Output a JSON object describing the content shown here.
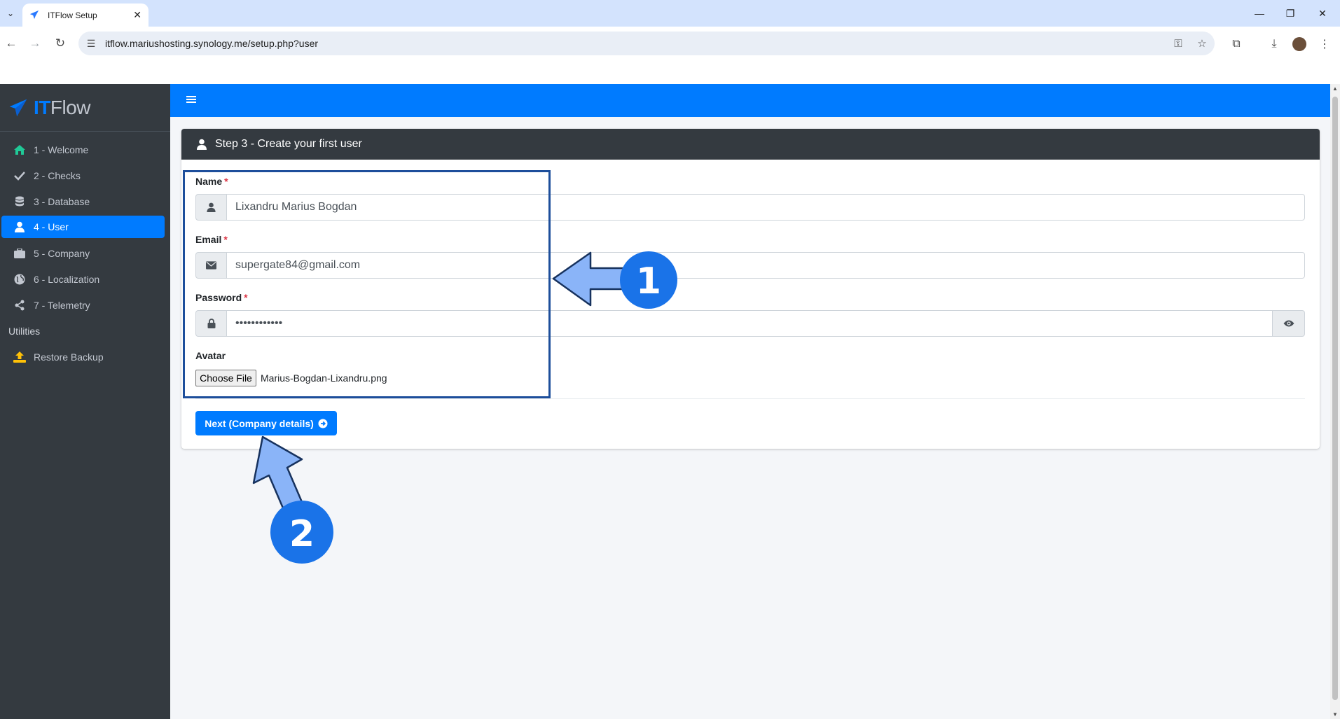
{
  "browser": {
    "tab_title": "ITFlow Setup",
    "url": "itflow.mariushosting.synology.me/setup.php?user"
  },
  "sidebar": {
    "brand_it": "IT",
    "brand_flow": "Flow",
    "items": [
      {
        "label": "1 - Welcome",
        "icon": "home-icon"
      },
      {
        "label": "2 - Checks",
        "icon": "check-icon"
      },
      {
        "label": "3 - Database",
        "icon": "database-icon"
      },
      {
        "label": "4 - User",
        "icon": "user-icon",
        "active": true
      },
      {
        "label": "5 - Company",
        "icon": "briefcase-icon"
      },
      {
        "label": "6 - Localization",
        "icon": "globe-icon"
      },
      {
        "label": "7 - Telemetry",
        "icon": "share-icon"
      }
    ],
    "utilities_header": "Utilities",
    "restore_label": "Restore Backup"
  },
  "card": {
    "title": "Step 3 - Create your first user"
  },
  "form": {
    "name_label": "Name",
    "name_value": "Lixandru Marius Bogdan",
    "email_label": "Email",
    "email_value": "supergate84@gmail.com",
    "password_label": "Password",
    "password_value": "••••••••••••",
    "avatar_label": "Avatar",
    "choose_file_label": "Choose File",
    "file_name": "Marius-Bogdan-Lixandru.png",
    "required_mark": "*"
  },
  "actions": {
    "next_label": "Next (Company details)"
  },
  "annotations": {
    "step1": "1",
    "step2": "2"
  },
  "colors": {
    "primary": "#007bff",
    "sidebar_bg": "#343a40",
    "highlight_border": "#1d4e9b",
    "annotation_arrow": "#8ab4f8",
    "annotation_badge": "#1a73e8"
  }
}
